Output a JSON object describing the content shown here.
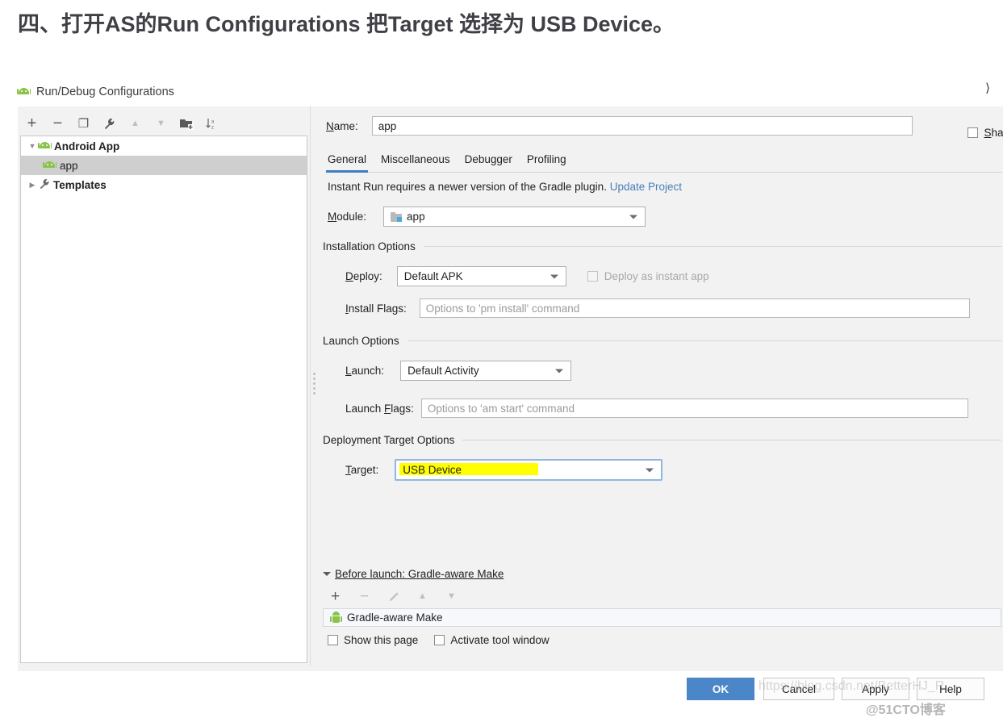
{
  "heading": "四、打开AS的Run Configurations 把Target 选择为 USB Device。",
  "dialog": {
    "title": "Run/Debug Configurations",
    "close_glyph": "⟩"
  },
  "left_panel": {
    "toolbar": [
      {
        "name": "add-icon",
        "glyph": "+",
        "disabled": false
      },
      {
        "name": "remove-icon",
        "glyph": "−",
        "disabled": false
      },
      {
        "name": "copy-icon",
        "glyph": "❐",
        "disabled": false
      },
      {
        "name": "wrench-icon",
        "glyph": "🔧",
        "disabled": false
      },
      {
        "name": "move-up-icon",
        "glyph": "▲",
        "disabled": true
      },
      {
        "name": "move-down-icon",
        "glyph": "▼",
        "disabled": true
      },
      {
        "name": "new-folder-icon",
        "glyph": "🗀",
        "disabled": false
      },
      {
        "name": "sort-alphabetically-icon",
        "glyph": "↓",
        "disabled": false
      }
    ],
    "tree": [
      {
        "label": "Android App",
        "expander": "▼",
        "icon": "android-icon",
        "selected": false,
        "bold": true,
        "indent": 0
      },
      {
        "label": "app",
        "expander": "",
        "icon": "android-icon",
        "selected": true,
        "bold": false,
        "indent": 1
      },
      {
        "label": "Templates",
        "expander": "▶",
        "icon": "wrench-icon",
        "selected": false,
        "bold": true,
        "indent": 0
      }
    ]
  },
  "right_panel": {
    "name_label": "Name:",
    "name_label_mnemonic": "N",
    "name_value": "app",
    "share_label": "Share",
    "share_checked": false,
    "tabs": [
      {
        "label": "General",
        "active": true
      },
      {
        "label": "Miscellaneous",
        "active": false
      },
      {
        "label": "Debugger",
        "active": false
      },
      {
        "label": "Profiling",
        "active": false
      }
    ],
    "instant_run_text": "Instant Run requires a newer version of the Gradle plugin.",
    "instant_run_link": "Update Project",
    "module_label": "Module:",
    "module_value": "app",
    "installation_options_label": "Installation Options",
    "deploy_label": "Deploy:",
    "deploy_value": "Default APK",
    "deploy_instant_label": "Deploy as instant app",
    "deploy_instant_checked": false,
    "install_flags_label": "Install Flags:",
    "install_flags_placeholder": "Options to 'pm install' command",
    "install_flags_value": "",
    "launch_options_label": "Launch Options",
    "launch_label": "Launch:",
    "launch_value": "Default Activity",
    "launch_flags_label": "Launch Flags:",
    "launch_flags_placeholder": "Options to 'am start' command",
    "launch_flags_value": "",
    "deployment_target_options_label": "Deployment Target Options",
    "target_label": "Target:",
    "target_value": "USB Device",
    "target_highlight_color": "#ffff00",
    "before_launch_label": "Before launch: Gradle-aware Make",
    "before_launch_toolbar": [
      {
        "name": "add-task-icon",
        "glyph": "+",
        "disabled": false
      },
      {
        "name": "remove-task-icon",
        "glyph": "−",
        "disabled": true
      },
      {
        "name": "edit-task-icon",
        "glyph": "✎",
        "disabled": true
      },
      {
        "name": "task-move-up-icon",
        "glyph": "▲",
        "disabled": true
      },
      {
        "name": "task-move-down-icon",
        "glyph": "▼",
        "disabled": true
      }
    ],
    "before_launch_item": "Gradle-aware Make",
    "show_this_page_label": "Show this page",
    "show_this_page_checked": false,
    "activate_tool_window_label": "Activate tool window",
    "activate_tool_window_checked": false
  },
  "footer": {
    "ok_label": "OK",
    "cancel_label": "Cancel",
    "apply_label": "Apply",
    "help_label": "Help",
    "accent_color": "#4a86c8"
  },
  "watermarks": {
    "url": "https://blog.csdn.net/BetterHJ_R",
    "site": "@51CTO博客"
  }
}
